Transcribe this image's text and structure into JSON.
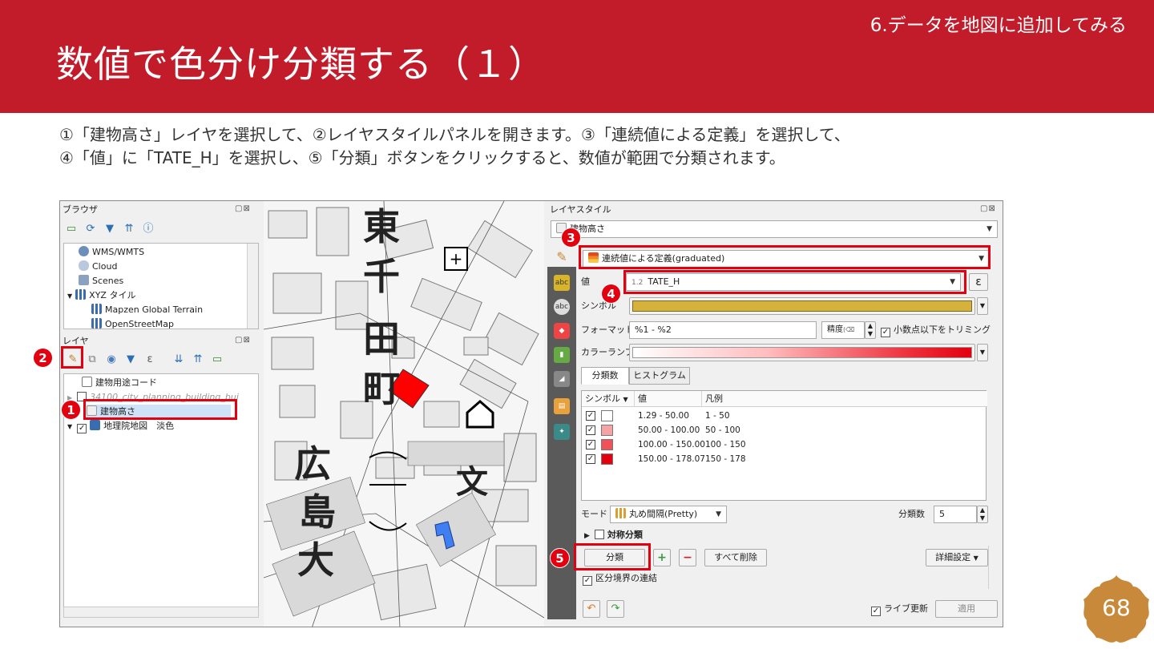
{
  "slide": {
    "section": "6.データを地図に追加してみる",
    "title": "数値で色分け分類する（１）",
    "description_line1": "①「建物高さ」レイヤを選択して、②レイヤスタイルパネルを開きます。③「連続値による定義」を選択して、",
    "description_line2": "④「値」に「TATE_H」を選択し、⑤「分類」ボタンをクリックすると、数値が範囲で分類されます。",
    "page_number": "68"
  },
  "browser": {
    "title": "ブラウザ",
    "items": [
      {
        "label": "WMS/WMTS",
        "icon": "globe-icon"
      },
      {
        "label": "Cloud",
        "icon": "cloud-icon"
      },
      {
        "label": "Scenes",
        "icon": "cube-icon"
      },
      {
        "label": "XYZ タイル",
        "icon": "grid-icon"
      },
      {
        "label": "Mapzen Global Terrain",
        "icon": "grid-icon"
      },
      {
        "label": "OpenStreetMap",
        "icon": "grid-icon"
      }
    ]
  },
  "layers": {
    "title": "レイヤ",
    "items": [
      {
        "label": "建物用途コード"
      },
      {
        "label": "34100_city_planning_building_bui"
      },
      {
        "label": "建物高さ"
      },
      {
        "label": "地理院地図　淡色"
      }
    ]
  },
  "map": {
    "labels": [
      "東",
      "千",
      "田",
      "町",
      "広",
      "島",
      "大",
      "文"
    ]
  },
  "style": {
    "title": "レイヤスタイル",
    "layer_select": "建物高さ",
    "renderer": "連続値による定義(graduated)",
    "value_label": "値",
    "value_field": "TATE_H",
    "value_type": "1.2",
    "symbol_label": "シンボル",
    "format_label": "フォーマット",
    "format_value": "%1 - %2",
    "precision": "精度",
    "trim_label": "小数点以下をトリミング",
    "ramp_label": "カラーランプ",
    "tabs": [
      "分類数",
      "ヒストグラム"
    ],
    "table_headers": [
      "シンボル",
      "値",
      "凡例"
    ],
    "classes": [
      {
        "value": "1.29 - 50.00",
        "legend": "1 - 50",
        "color": "#ffffff"
      },
      {
        "value": "50.00 - 100.00",
        "legend": "50 - 100",
        "color": "#f6a3a6"
      },
      {
        "value": "100.00 - 150.00",
        "legend": "100 - 150",
        "color": "#f15259"
      },
      {
        "value": "150.00 - 178.07",
        "legend": "150 - 178",
        "color": "#e3000f"
      }
    ],
    "mode_label": "モード",
    "mode_value": "丸め間隔(Pretty)",
    "class_count_label": "分類数",
    "class_count": "5",
    "symmetric_label": "対称分類",
    "classify_button": "分類",
    "delete_all_button": "すべて削除",
    "advanced_button": "詳細設定",
    "link_boundaries": "区分境界の連結",
    "live_update": "ライブ更新",
    "apply_button": "適用"
  },
  "annotations": [
    "1",
    "2",
    "3",
    "4",
    "5"
  ],
  "colors": {
    "header": "#c21b2a",
    "annotation": "#e3000f",
    "symbol_fill": "#d4b23c",
    "badge": "#c88a3a"
  }
}
